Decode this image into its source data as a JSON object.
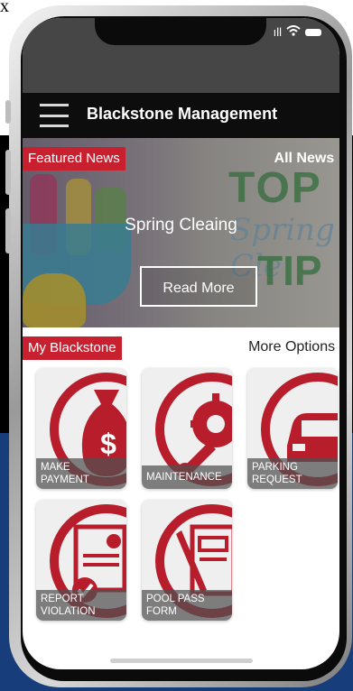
{
  "page_corner_text": "x",
  "status_bar": {
    "signal": "ıll"
  },
  "appbar": {
    "title": "Blackstone Management"
  },
  "banner": {
    "featured_label": "Featured News",
    "all_news_label": "All News :",
    "article_title": "Spring Cleaing",
    "read_more_label": "Read More",
    "image_text": {
      "top": "TOP",
      "mid": "Spring Cle",
      "bottom": "TIP"
    }
  },
  "section": {
    "title": "My Blackstone",
    "more_options_label": "More Options :"
  },
  "tiles": [
    {
      "line1": "MAKE",
      "line2": "PAYMENT",
      "icon": "money-bag-icon"
    },
    {
      "line1": "MAINTENANCE",
      "line2": "",
      "icon": "gear-wrench-icon"
    },
    {
      "line1": "PARKING",
      "line2": "REQUEST",
      "icon": "car-icon"
    },
    {
      "line1": "REPORT",
      "line2": "VIOLATION",
      "icon": "document-check-icon"
    },
    {
      "line1": "POOL PASS",
      "line2": "FORM",
      "icon": "form-pen-icon"
    }
  ],
  "colors": {
    "accent": "#c8202f",
    "appbar": "#0d0d0d",
    "status_bar": "#464646",
    "background_blue": "#173d7a"
  }
}
